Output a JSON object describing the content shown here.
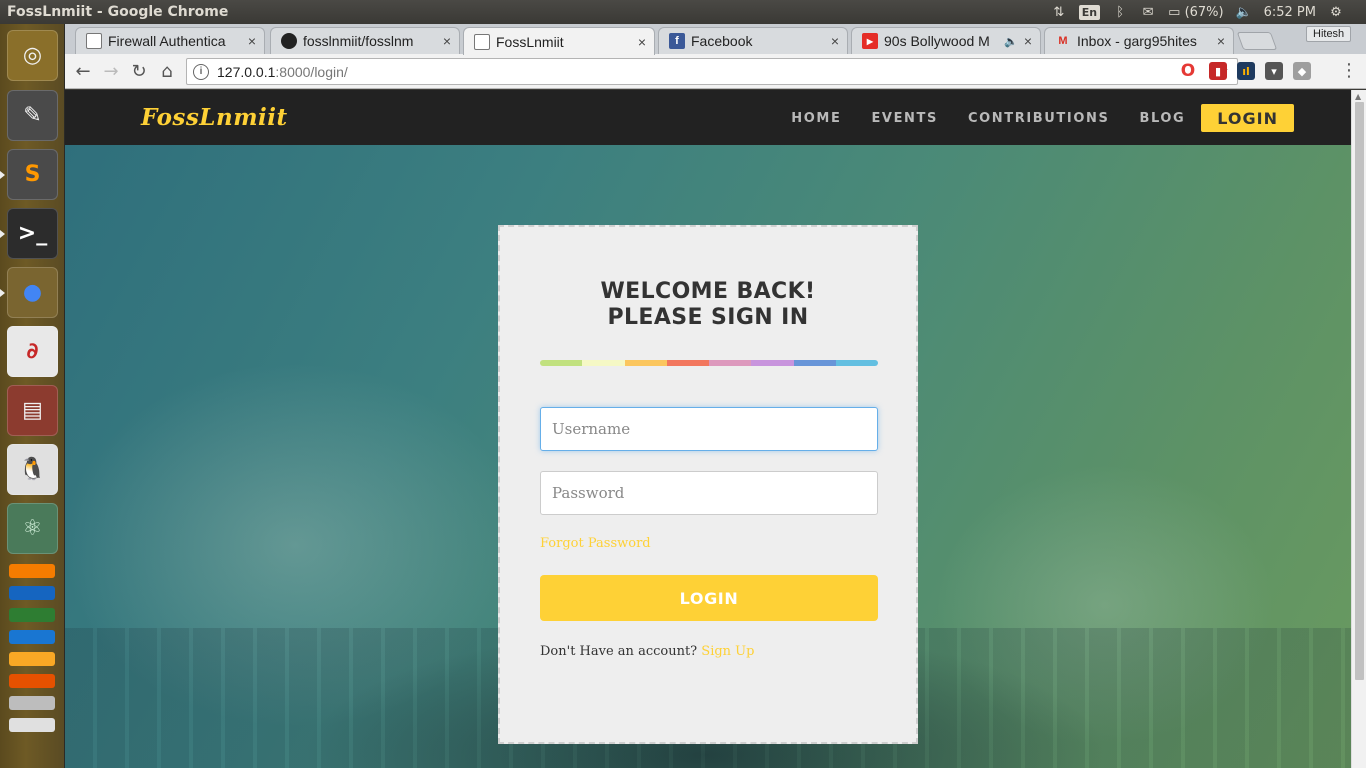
{
  "os": {
    "window_title": "FossLnmiit - Google Chrome",
    "lang": "En",
    "battery": "(67%)",
    "clock": "6:52 PM"
  },
  "launcher": {
    "apps": [
      {
        "name": "ubuntu-dash-icon",
        "bg": "#8a6f2a",
        "glyph": "◎",
        "color": "#f0f0f0"
      },
      {
        "name": "text-editor-icon",
        "bg": "#4a4a4a",
        "glyph": "✎",
        "color": "#f5f5f5"
      },
      {
        "name": "sublime-text-icon",
        "bg": "#4a4a4a",
        "glyph": "S",
        "color": "#ff9800"
      },
      {
        "name": "terminal-icon",
        "bg": "#2c2c2c",
        "glyph": ">_",
        "color": "#ffffff"
      },
      {
        "name": "chrome-icon",
        "bg": "#7a6530",
        "glyph": "●",
        "color": "#4285f4"
      },
      {
        "name": "document-viewer-icon",
        "bg": "#e8e8e8",
        "glyph": "∂",
        "color": "#c62828"
      },
      {
        "name": "file-archive-icon",
        "bg": "#8c3b2f",
        "glyph": "▤",
        "color": "#f0f0f0"
      },
      {
        "name": "linux-penguin-icon",
        "bg": "#e0e0e0",
        "glyph": "🐧",
        "color": "#222"
      },
      {
        "name": "atom-editor-icon",
        "bg": "#4a7a5a",
        "glyph": "⚛",
        "color": "#d8f5e0"
      }
    ]
  },
  "browser": {
    "tabs": [
      {
        "label": "Firewall Authentica",
        "favicon": "📄"
      },
      {
        "label": "fosslnmiit/fosslnm",
        "favicon": "●"
      },
      {
        "label": "FossLnmiit",
        "favicon": "📄"
      },
      {
        "label": "Facebook",
        "favicon": "f"
      },
      {
        "label": "90s Bollywood M",
        "favicon": "▶"
      },
      {
        "label": "Inbox - garg95hites",
        "favicon": "M"
      }
    ],
    "close_glyph": "×",
    "profile_name": "Hitesh",
    "url_host": "127.0.0.1",
    "url_path": ":8000/login/"
  },
  "site": {
    "brand": "FossLnmiit",
    "nav": [
      {
        "label": "HOME"
      },
      {
        "label": "EVENTS"
      },
      {
        "label": "CONTRIBUTIONS"
      },
      {
        "label": "BLOG"
      }
    ],
    "nav_login": "LOGIN"
  },
  "login": {
    "title": "WELCOME BACK! PLEASE SIGN IN",
    "rainbow_colors": [
      "#c1e17f",
      "#f5f8c5",
      "#fbc65e",
      "#f2775e",
      "#dd99bd",
      "#c894dd",
      "#6895d8",
      "#63bfe1"
    ],
    "username_placeholder": "Username",
    "username_value": "",
    "password_placeholder": "Password",
    "password_value": "",
    "forgot_label": "Forgot Password",
    "submit_label": "LOGIN",
    "signup_prompt": "Don't Have an account?",
    "signup_link": "Sign Up"
  },
  "colors": {
    "accent": "#fed136",
    "navbar": "#222222"
  }
}
